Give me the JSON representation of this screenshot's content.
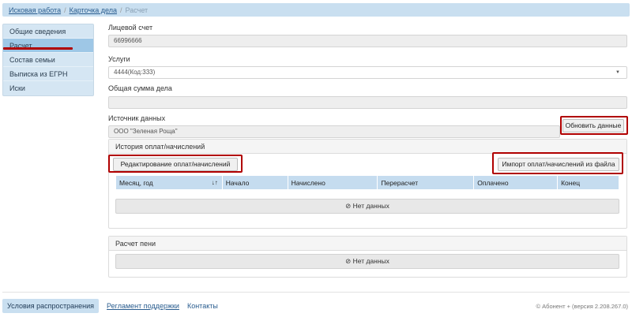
{
  "breadcrumb": {
    "items": [
      "Исковая работа",
      "Карточка дела"
    ],
    "current": "Расчет"
  },
  "sidebar": {
    "items": [
      {
        "label": "Общие сведения"
      },
      {
        "label": "Расчет"
      },
      {
        "label": "Состав семьи"
      },
      {
        "label": "Выписка из ЕГРН"
      },
      {
        "label": "Иски"
      }
    ],
    "active_index": 1
  },
  "form": {
    "account_label": "Лицевой счет",
    "account_value": "66996666",
    "services_label": "Услуги",
    "services_value": "4444(Код:333)",
    "total_label": "Общая сумма дела",
    "total_value": "",
    "source_label": "Источник данных",
    "source_value": "ООО \"Зеленая Роща\"",
    "refresh_button": "Обновить данные"
  },
  "history": {
    "title": "История оплат/начислений",
    "edit_button": "Редактирование оплат/начислений",
    "import_button": "Импорт оплат/начислений из файла",
    "columns": [
      "Месяц, год",
      "Начало",
      "Начислено",
      "Перерасчет",
      "Оплачено",
      "Конец"
    ],
    "sort_glyph": "↓↑",
    "no_data": "Нет данных"
  },
  "penalty": {
    "title": "Расчет пени",
    "no_data": "Нет данных"
  },
  "footer": {
    "terms": "Условия распространения",
    "support": "Регламент поддержки",
    "contacts": "Контакты",
    "version": "© Абонент + (версия 2.208.267.0)"
  },
  "colors": {
    "highlight": "#b00000",
    "accent": "#c9dff0",
    "table_header": "#c5dcef"
  },
  "icons": {
    "no_data": "ban-icon",
    "dropdown": "caret-down-icon",
    "sort": "sort-icon"
  }
}
